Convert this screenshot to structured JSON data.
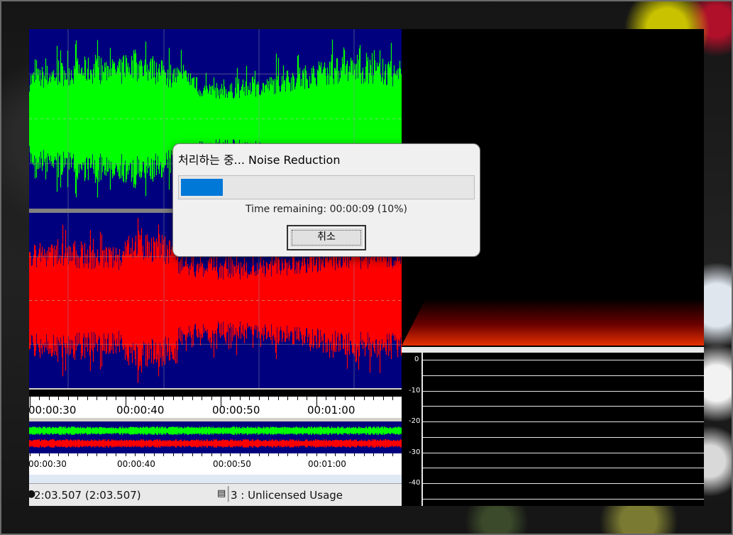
{
  "dialog": {
    "title": "처리하는 중... Noise Reduction",
    "progress_percent": 10,
    "time_remaining": "Time remaining: 00:00:09 (10%)",
    "cancel_label": "취소"
  },
  "timeline": {
    "labels": [
      "00:00:30",
      "00:00:40",
      "00:00:50",
      "00:01:00"
    ]
  },
  "overview": {
    "labels": [
      "00:00:30",
      "00:00:40",
      "00:00:50",
      "00:01:00"
    ]
  },
  "status_bar": {
    "time": "2:03.507 (2:03.507)",
    "license": "3 : Unlicensed Usage"
  },
  "level_meter": {
    "labels": [
      "0",
      "-10",
      "-20",
      "-30",
      "-40"
    ]
  },
  "colors": {
    "wave_background": "#00007f",
    "left_channel": "#00ff00",
    "right_channel": "#ff0000",
    "progress_fill": "#0078d7"
  }
}
